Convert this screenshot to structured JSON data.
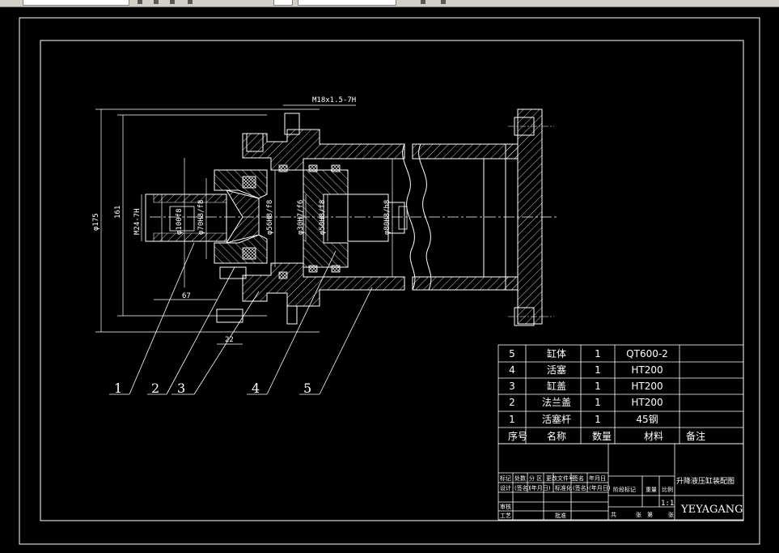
{
  "toolbar": {
    "fields": [
      "",
      "",
      ""
    ],
    "icons": [
      "layer-icon",
      "color-icon",
      "linetype-icon",
      "lineweight-icon",
      "plot-icon",
      "pan-icon",
      "zoom-icon"
    ]
  },
  "drawing": {
    "dimensions": {
      "thread_top": "M18x1.5-7H",
      "d175": "φ175",
      "d161": "161",
      "m24": "M24-7H",
      "d100": "φ100f8",
      "d70": "φ70H8/f8",
      "d56": "φ56H8/f8",
      "d30": "φ30H7/f6",
      "d50": "φ50H8/f8",
      "d80": "φ80H8/h8",
      "len67": "67",
      "len22": "22"
    },
    "balloons": [
      "1",
      "2",
      "3",
      "4",
      "5"
    ]
  },
  "parts_list": {
    "rows": [
      {
        "no": "5",
        "name": "缸体",
        "qty": "1",
        "material": "QT600-2",
        "note": ""
      },
      {
        "no": "4",
        "name": "活塞",
        "qty": "1",
        "material": "HT200",
        "note": ""
      },
      {
        "no": "3",
        "name": "缸盖",
        "qty": "1",
        "material": "HT200",
        "note": ""
      },
      {
        "no": "2",
        "name": "法兰盖",
        "qty": "1",
        "material": "HT200",
        "note": ""
      },
      {
        "no": "1",
        "name": "活塞杆",
        "qty": "1",
        "material": "45钢",
        "note": ""
      }
    ],
    "header": {
      "no": "序号",
      "name": "名称",
      "qty": "数量",
      "material": "材料",
      "note": "备注"
    }
  },
  "title_block": {
    "title": "升降液压缸装配图",
    "company": "YEYAGANG",
    "scale": "1:1",
    "row1": [
      "标记",
      "处数",
      "分 区",
      "更改文件号",
      "签名",
      "年月日"
    ],
    "row2": [
      "设计",
      "(签名)",
      "(年月日)",
      "标准化",
      "(签名)",
      "(年月日)"
    ],
    "review": "审核",
    "process": "工艺",
    "approve": "批准",
    "stage_mark": "阶段标记",
    "weight": "重量",
    "scale_label": "比例",
    "sheets": "共",
    "sheet_word": "张",
    "sheet_no": "第",
    "sheet_word2": "张"
  }
}
